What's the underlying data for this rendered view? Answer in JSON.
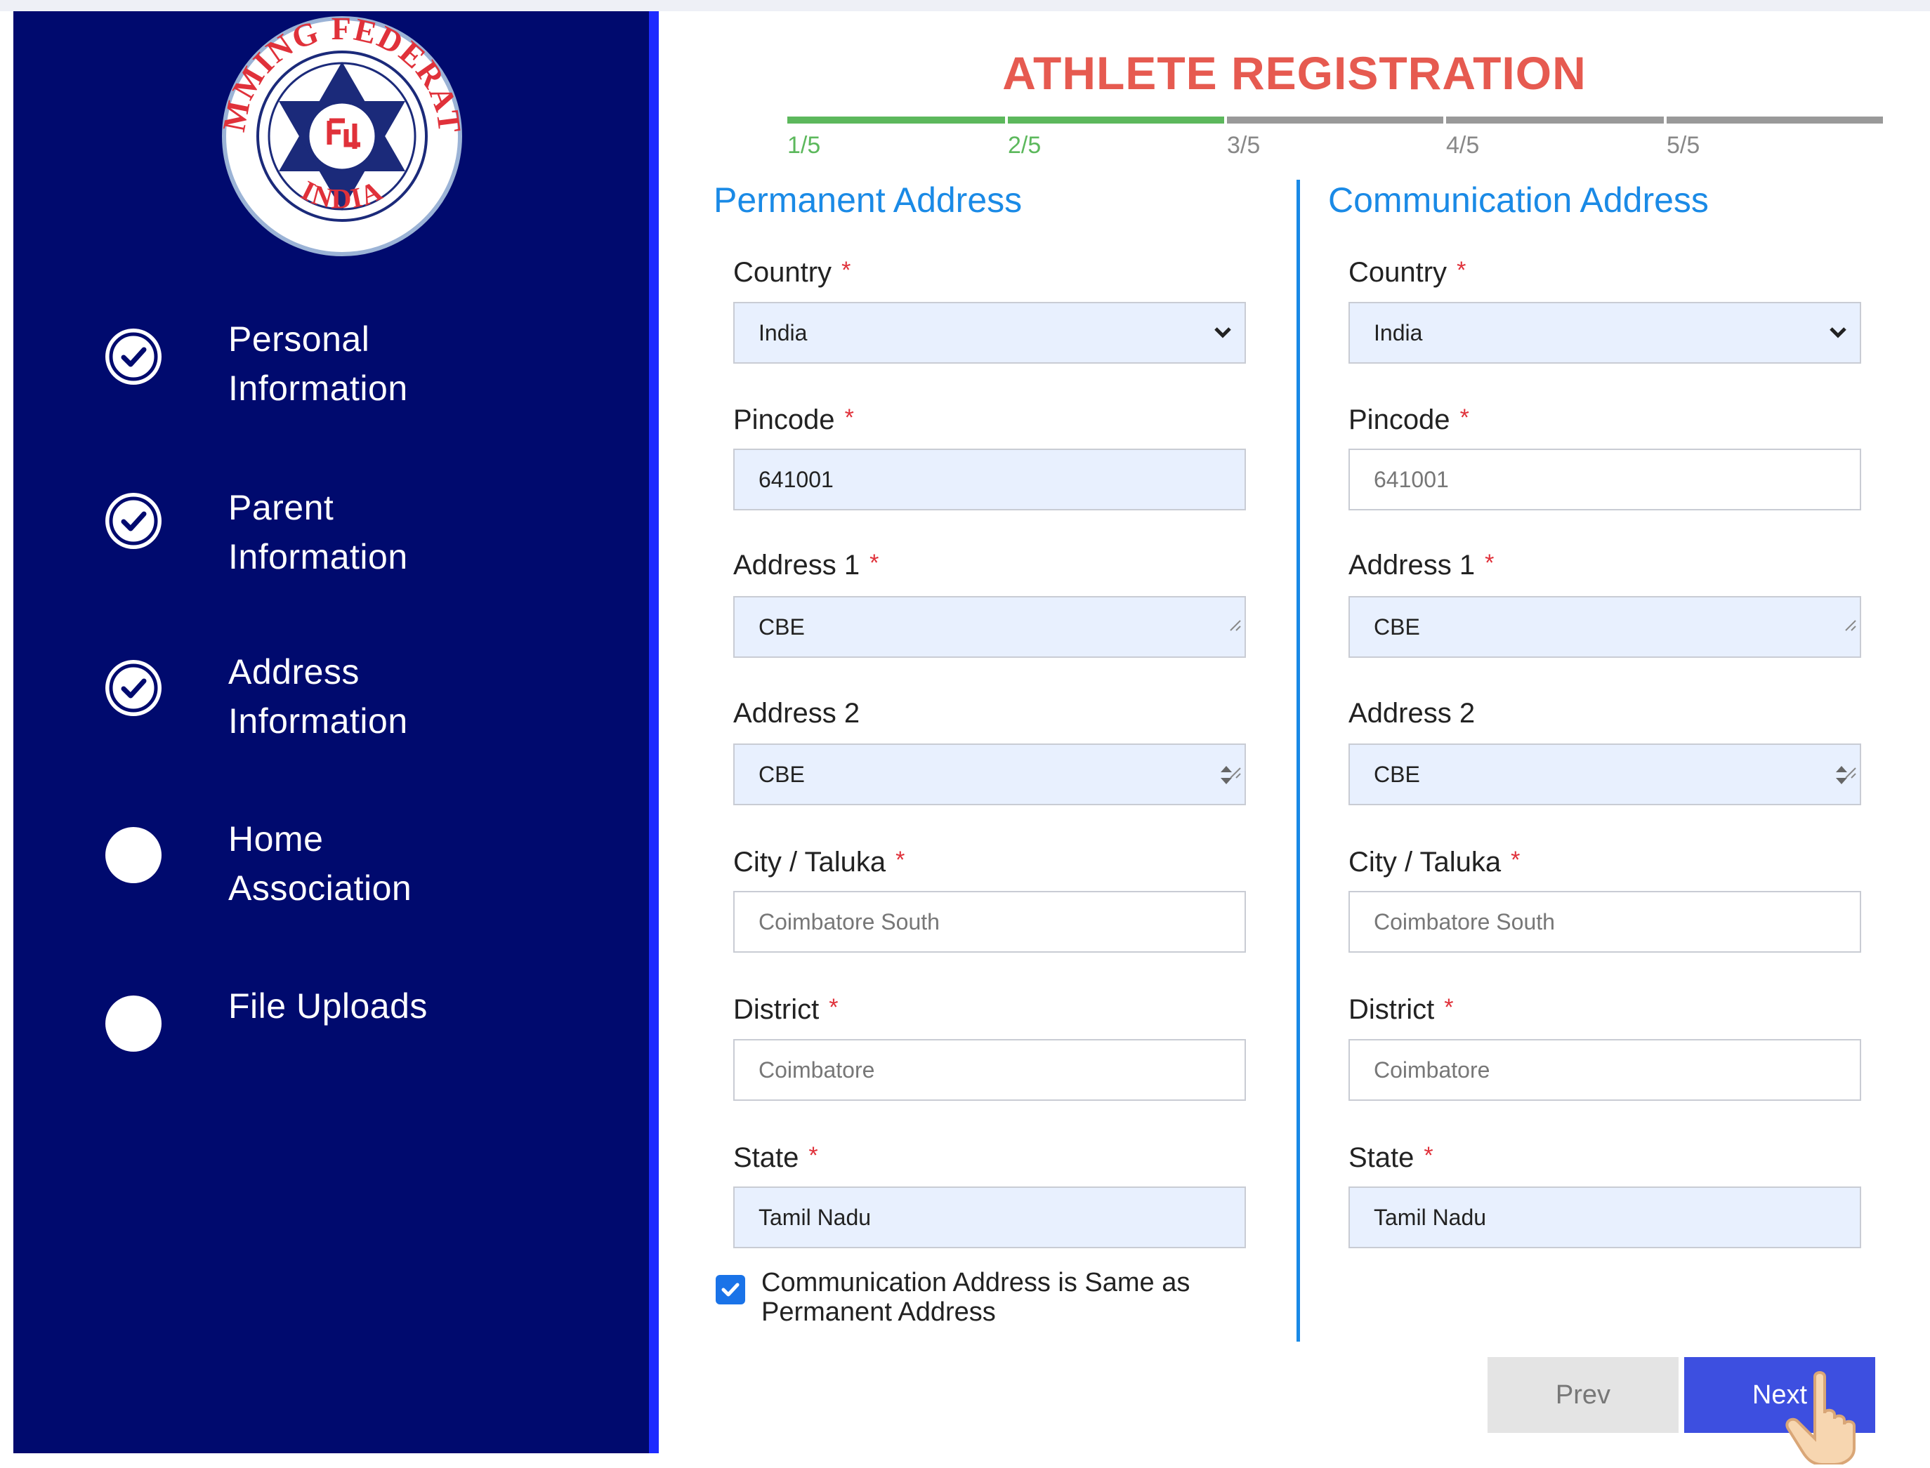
{
  "logo": {
    "top_text": "SWIMMING FEDERATION",
    "bottom_text": "INDIA"
  },
  "sidebar": {
    "steps": [
      {
        "label": "Personal\nInformation",
        "state": "complete"
      },
      {
        "label": "Parent\nInformation",
        "state": "complete"
      },
      {
        "label": "Address\nInformation",
        "state": "complete"
      },
      {
        "label": "Home\nAssociation",
        "state": "pending"
      },
      {
        "label": "File Uploads",
        "state": "pending"
      }
    ]
  },
  "header": {
    "title": "ATHLETE REGISTRATION"
  },
  "progress": {
    "current_step": 2,
    "total_steps": 5,
    "labels": [
      "1/5",
      "2/5",
      "3/5",
      "4/5",
      "5/5"
    ]
  },
  "required_marker": "*",
  "permanent": {
    "heading": "Permanent Address",
    "country_label": "Country",
    "country_value": "India",
    "pincode_label": "Pincode",
    "pincode_value": "641001",
    "address1_label": "Address 1",
    "address1_value": "CBE",
    "address2_label": "Address 2",
    "address2_value": "CBE",
    "city_label": "City / Taluka",
    "city_placeholder": "Coimbatore South",
    "district_label": "District",
    "district_placeholder": "Coimbatore",
    "state_label": "State",
    "state_value": "Tamil Nadu"
  },
  "communication": {
    "heading": "Communication Address",
    "country_label": "Country",
    "country_value": "India",
    "pincode_label": "Pincode",
    "pincode_placeholder": "641001",
    "address1_label": "Address 1",
    "address1_value": "CBE",
    "address2_label": "Address 2",
    "address2_value": "CBE",
    "city_label": "City / Taluka",
    "city_placeholder": "Coimbatore South",
    "district_label": "District",
    "district_placeholder": "Coimbatore",
    "state_label": "State",
    "state_value": "Tamil Nadu"
  },
  "same_address": {
    "checked": true,
    "label": "Communication Address is Same as Permanent Address"
  },
  "buttons": {
    "prev": "Prev",
    "next": "Next"
  },
  "colors": {
    "sidebar_bg": "#000a6e",
    "title": "#e65a50",
    "section_heading": "#1a8ae6",
    "progress_done": "#5cb85c",
    "next_button": "#3d4fe0"
  }
}
